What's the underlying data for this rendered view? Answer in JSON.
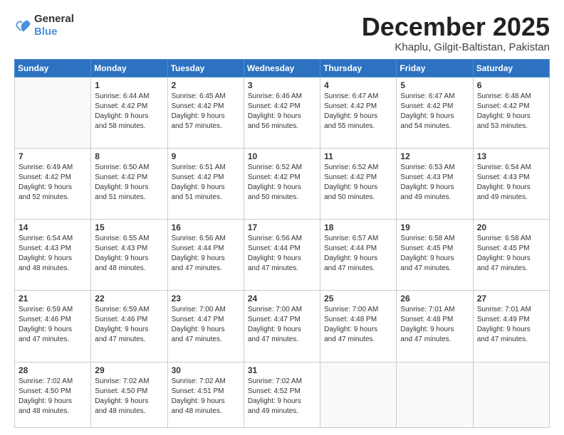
{
  "header": {
    "logo_general": "General",
    "logo_blue": "Blue",
    "month_title": "December 2025",
    "location": "Khaplu, Gilgit-Baltistan, Pakistan"
  },
  "weekdays": [
    "Sunday",
    "Monday",
    "Tuesday",
    "Wednesday",
    "Thursday",
    "Friday",
    "Saturday"
  ],
  "weeks": [
    [
      {
        "day": "",
        "info": ""
      },
      {
        "day": "1",
        "info": "Sunrise: 6:44 AM\nSunset: 4:42 PM\nDaylight: 9 hours\nand 58 minutes."
      },
      {
        "day": "2",
        "info": "Sunrise: 6:45 AM\nSunset: 4:42 PM\nDaylight: 9 hours\nand 57 minutes."
      },
      {
        "day": "3",
        "info": "Sunrise: 6:46 AM\nSunset: 4:42 PM\nDaylight: 9 hours\nand 56 minutes."
      },
      {
        "day": "4",
        "info": "Sunrise: 6:47 AM\nSunset: 4:42 PM\nDaylight: 9 hours\nand 55 minutes."
      },
      {
        "day": "5",
        "info": "Sunrise: 6:47 AM\nSunset: 4:42 PM\nDaylight: 9 hours\nand 54 minutes."
      },
      {
        "day": "6",
        "info": "Sunrise: 6:48 AM\nSunset: 4:42 PM\nDaylight: 9 hours\nand 53 minutes."
      }
    ],
    [
      {
        "day": "7",
        "info": "Sunrise: 6:49 AM\nSunset: 4:42 PM\nDaylight: 9 hours\nand 52 minutes."
      },
      {
        "day": "8",
        "info": "Sunrise: 6:50 AM\nSunset: 4:42 PM\nDaylight: 9 hours\nand 51 minutes."
      },
      {
        "day": "9",
        "info": "Sunrise: 6:51 AM\nSunset: 4:42 PM\nDaylight: 9 hours\nand 51 minutes."
      },
      {
        "day": "10",
        "info": "Sunrise: 6:52 AM\nSunset: 4:42 PM\nDaylight: 9 hours\nand 50 minutes."
      },
      {
        "day": "11",
        "info": "Sunrise: 6:52 AM\nSunset: 4:42 PM\nDaylight: 9 hours\nand 50 minutes."
      },
      {
        "day": "12",
        "info": "Sunrise: 6:53 AM\nSunset: 4:43 PM\nDaylight: 9 hours\nand 49 minutes."
      },
      {
        "day": "13",
        "info": "Sunrise: 6:54 AM\nSunset: 4:43 PM\nDaylight: 9 hours\nand 49 minutes."
      }
    ],
    [
      {
        "day": "14",
        "info": "Sunrise: 6:54 AM\nSunset: 4:43 PM\nDaylight: 9 hours\nand 48 minutes."
      },
      {
        "day": "15",
        "info": "Sunrise: 6:55 AM\nSunset: 4:43 PM\nDaylight: 9 hours\nand 48 minutes."
      },
      {
        "day": "16",
        "info": "Sunrise: 6:56 AM\nSunset: 4:44 PM\nDaylight: 9 hours\nand 47 minutes."
      },
      {
        "day": "17",
        "info": "Sunrise: 6:56 AM\nSunset: 4:44 PM\nDaylight: 9 hours\nand 47 minutes."
      },
      {
        "day": "18",
        "info": "Sunrise: 6:57 AM\nSunset: 4:44 PM\nDaylight: 9 hours\nand 47 minutes."
      },
      {
        "day": "19",
        "info": "Sunrise: 6:58 AM\nSunset: 4:45 PM\nDaylight: 9 hours\nand 47 minutes."
      },
      {
        "day": "20",
        "info": "Sunrise: 6:58 AM\nSunset: 4:45 PM\nDaylight: 9 hours\nand 47 minutes."
      }
    ],
    [
      {
        "day": "21",
        "info": "Sunrise: 6:59 AM\nSunset: 4:46 PM\nDaylight: 9 hours\nand 47 minutes."
      },
      {
        "day": "22",
        "info": "Sunrise: 6:59 AM\nSunset: 4:46 PM\nDaylight: 9 hours\nand 47 minutes."
      },
      {
        "day": "23",
        "info": "Sunrise: 7:00 AM\nSunset: 4:47 PM\nDaylight: 9 hours\nand 47 minutes."
      },
      {
        "day": "24",
        "info": "Sunrise: 7:00 AM\nSunset: 4:47 PM\nDaylight: 9 hours\nand 47 minutes."
      },
      {
        "day": "25",
        "info": "Sunrise: 7:00 AM\nSunset: 4:48 PM\nDaylight: 9 hours\nand 47 minutes."
      },
      {
        "day": "26",
        "info": "Sunrise: 7:01 AM\nSunset: 4:48 PM\nDaylight: 9 hours\nand 47 minutes."
      },
      {
        "day": "27",
        "info": "Sunrise: 7:01 AM\nSunset: 4:49 PM\nDaylight: 9 hours\nand 47 minutes."
      }
    ],
    [
      {
        "day": "28",
        "info": "Sunrise: 7:02 AM\nSunset: 4:50 PM\nDaylight: 9 hours\nand 48 minutes."
      },
      {
        "day": "29",
        "info": "Sunrise: 7:02 AM\nSunset: 4:50 PM\nDaylight: 9 hours\nand 48 minutes."
      },
      {
        "day": "30",
        "info": "Sunrise: 7:02 AM\nSunset: 4:51 PM\nDaylight: 9 hours\nand 48 minutes."
      },
      {
        "day": "31",
        "info": "Sunrise: 7:02 AM\nSunset: 4:52 PM\nDaylight: 9 hours\nand 49 minutes."
      },
      {
        "day": "",
        "info": ""
      },
      {
        "day": "",
        "info": ""
      },
      {
        "day": "",
        "info": ""
      }
    ]
  ]
}
